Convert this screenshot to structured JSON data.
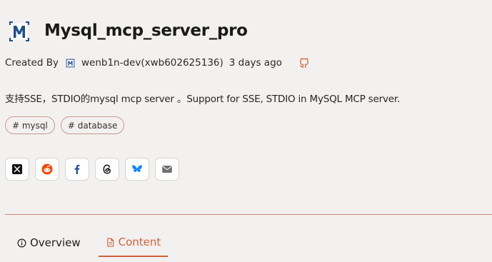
{
  "header": {
    "title": "Mysql_mcp_server_pro"
  },
  "meta": {
    "created_by_label": "Created By",
    "author": "wenb1n-dev(xwb602625136)",
    "time_ago": "3 days ago"
  },
  "description": "支持SSE，STDIO的mysql mcp server 。Support for SSE, STDIO in MySQL MCP server.",
  "tags": [
    {
      "label": "# mysql"
    },
    {
      "label": "# database"
    }
  ],
  "share": [
    {
      "icon": "x-icon"
    },
    {
      "icon": "reddit-icon"
    },
    {
      "icon": "facebook-icon"
    },
    {
      "icon": "threads-icon"
    },
    {
      "icon": "bluesky-icon"
    },
    {
      "icon": "email-icon"
    }
  ],
  "tabs": [
    {
      "label": "Overview",
      "active": false
    },
    {
      "label": "Content",
      "active": true
    }
  ],
  "colors": {
    "accent": "#d0603a",
    "brand_logo": "#1e4d8c"
  }
}
